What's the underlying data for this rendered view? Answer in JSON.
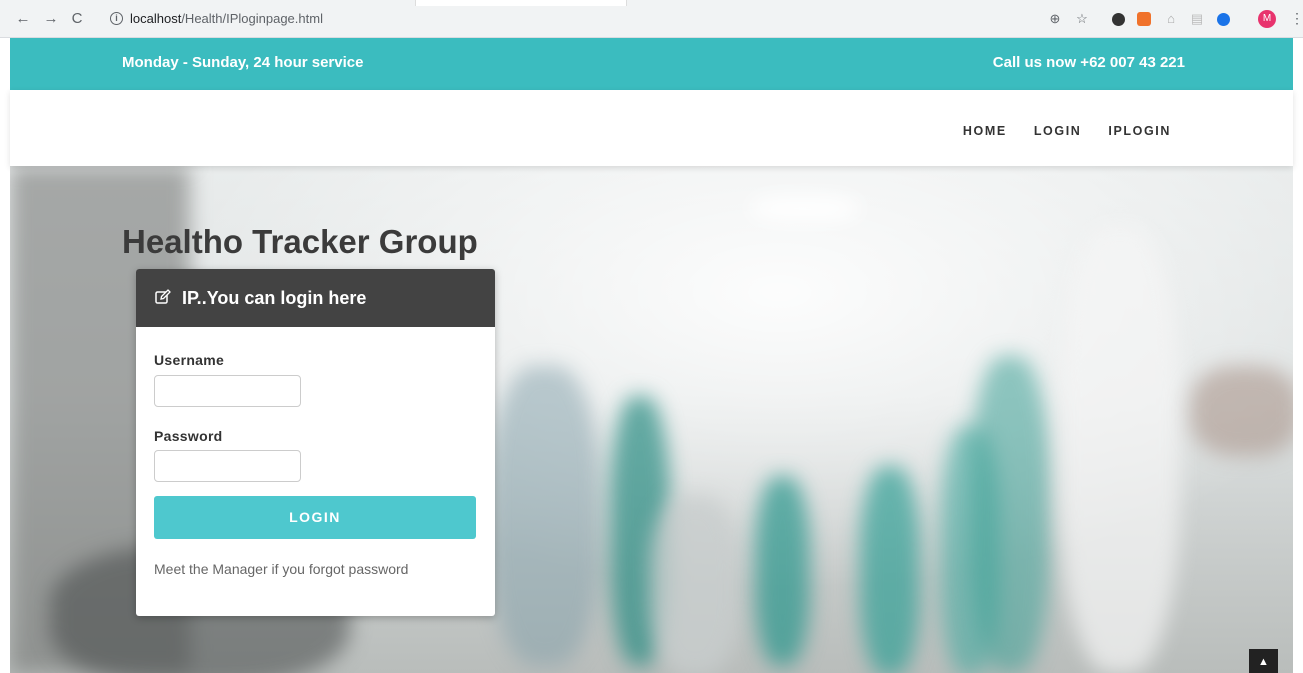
{
  "browser": {
    "url_host": "localhost",
    "url_path": "/Health/IPloginpage.html",
    "avatar_letter": "M"
  },
  "topbar": {
    "hours": "Monday - Sunday, 24 hour service",
    "call": "Call us now +62 007 43 221",
    "color": "#3bbcbf"
  },
  "nav": {
    "items": [
      {
        "label": "HOME"
      },
      {
        "label": "LOGIN"
      },
      {
        "label": "IPLOGIN"
      }
    ]
  },
  "hero": {
    "title": "Healtho Tracker Group"
  },
  "login_card": {
    "header": "IP..You can login here",
    "username_label": "Username",
    "password_label": "Password",
    "username_value": "",
    "password_value": "",
    "button": "LOGIN",
    "button_color": "#4ec8ce",
    "forgot_text": "Meet the Manager if you forgot password"
  },
  "icons": {
    "edit": "edit-icon",
    "scroll_top": "chevron-up-icon"
  }
}
